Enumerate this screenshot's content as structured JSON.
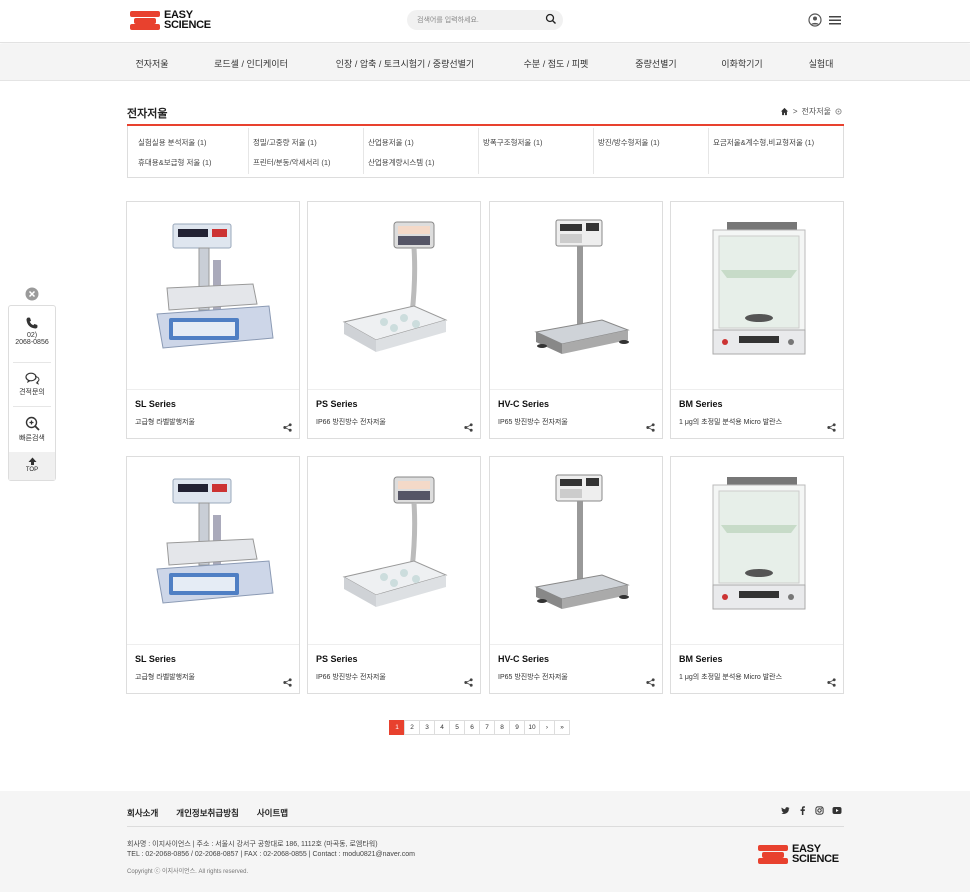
{
  "brand": {
    "line1": "EASY",
    "line2": "SCIENCE",
    "color": "#e8412e"
  },
  "search": {
    "placeholder": "검색어를 입력하세요."
  },
  "nav": [
    "전자저울",
    "로드셀 / 인디케이터",
    "인장 / 압축 / 토크시험기 / 중량선별기",
    "수분 / 점도 / 피펫",
    "중량선별기",
    "이화학기기",
    "실험대"
  ],
  "page": {
    "title": "전자저울",
    "crumb_current": "전자저울"
  },
  "categories": [
    [
      "실험실용 분석저울 (1)",
      "정밀/고중량 저울 (1)",
      "산업용저울 (1)",
      "방폭구조형저울 (1)",
      "방진/방수형저울 (1)",
      "요금저울&계수형,비교형저울 (1)"
    ],
    [
      "휴대용&보급형 저울 (1)",
      "프린터/분동/악세서리 (1)",
      "산업용계량시스템 (1)",
      "",
      "",
      ""
    ]
  ],
  "products": [
    {
      "title": "SL Series",
      "desc": "고급형 라벨발행저울",
      "icon": "label-scale"
    },
    {
      "title": "PS Series",
      "desc": "IP66 방진방수 전자저울",
      "icon": "platform-scale"
    },
    {
      "title": "HV-C Series",
      "desc": "IP65 방진방수 전자저울",
      "icon": "bench-scale"
    },
    {
      "title": "BM Series",
      "desc": "1 μg의 초정밀 분석용 Micro 발란스",
      "icon": "micro-balance"
    },
    {
      "title": "SL Series",
      "desc": "고급형 라벨발행저울",
      "icon": "label-scale"
    },
    {
      "title": "PS Series",
      "desc": "IP66 방진방수 전자저울",
      "icon": "platform-scale"
    },
    {
      "title": "HV-C Series",
      "desc": "IP65 방진방수 전자저울",
      "icon": "bench-scale"
    },
    {
      "title": "BM Series",
      "desc": "1 μg의 초정밀 분석용 Micro 발란스",
      "icon": "micro-balance"
    }
  ],
  "sidebar": {
    "phone_line1": "02)",
    "phone_line2": "2068-0856",
    "quote": "견적문의",
    "quick": "빠른검색",
    "top": "TOP"
  },
  "pagination": {
    "pages": [
      "1",
      "2",
      "3",
      "4",
      "5",
      "6",
      "7",
      "8",
      "9",
      "10"
    ],
    "next": "›",
    "last": "»",
    "current": "1"
  },
  "footer": {
    "links": [
      "회사소개",
      "개인정보취급방침",
      "사이트맵"
    ],
    "info1": "회사명 : 이지사이언스  |  주소 : 서울시 강서구 공항대로 186, 1112호 (마곡동, 로엠타워)",
    "info2": "TEL : 02-2068-0856 / 02-2068-0857  |  FAX : 02-2068-0855  |  Contact : modu0821@naver.com",
    "copyright": "Copyright ⓒ 이지사이언스. All rights reserved.",
    "social": [
      "twitter-icon",
      "facebook-icon",
      "instagram-icon",
      "youtube-icon"
    ]
  }
}
